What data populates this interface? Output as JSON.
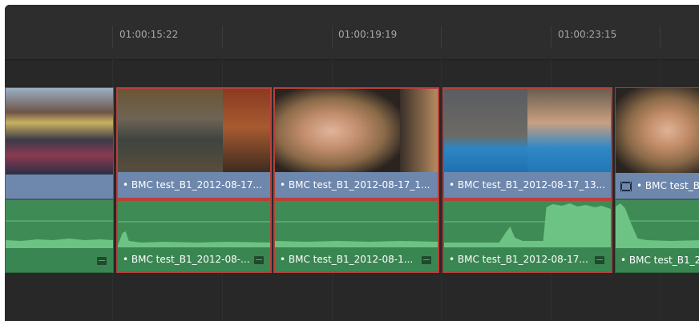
{
  "ruler": {
    "timecodes": [
      "01:00:15:22",
      "01:00:19:19",
      "01:00:23:15"
    ]
  },
  "video_clips": [
    {
      "name": ""
    },
    {
      "name": "BMC test_B1_2012-08-17..."
    },
    {
      "name": "BMC test_B1_2012-08-17_1..."
    },
    {
      "name": "BMC test_B1_2012-08-17_13..."
    },
    {
      "name": "BMC test_B"
    }
  ],
  "audio_clips": [
    {
      "name": ""
    },
    {
      "name": "BMC test_B1_2012-08-..."
    },
    {
      "name": "BMC test_B1_2012-08-1..."
    },
    {
      "name": "BMC test_B1_2012-08-17..."
    },
    {
      "name": "BMC test_B1_2"
    }
  ],
  "colors": {
    "selection": "#b8403a",
    "video_clip": "#7c94b6",
    "audio_clip": "#3f8b55"
  }
}
